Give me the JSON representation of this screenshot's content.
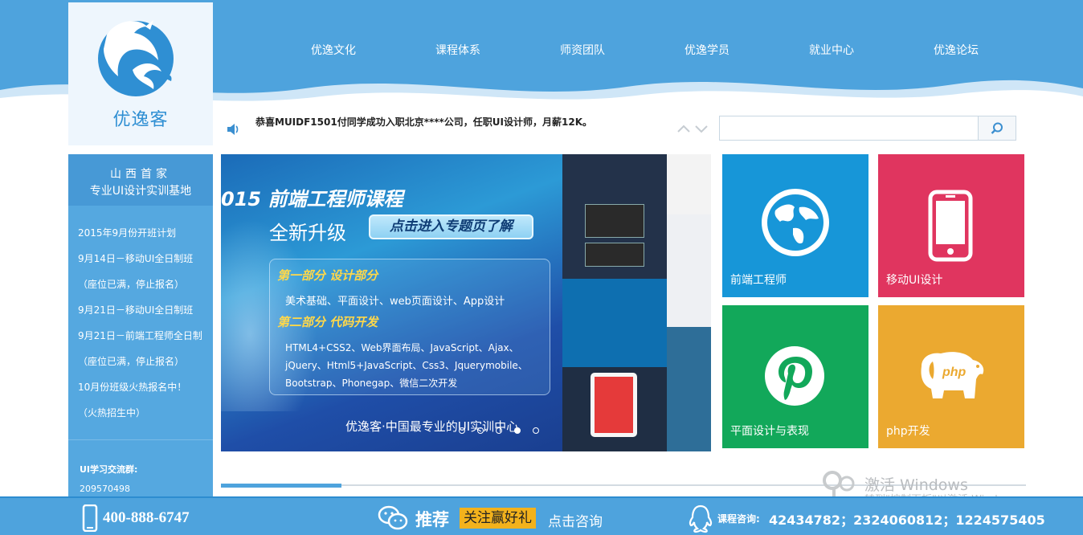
{
  "logo": {
    "text": "优逸客"
  },
  "nav": [
    "优逸文化",
    "课程体系",
    "师资团队",
    "优逸学员",
    "就业中心",
    "优逸论坛"
  ],
  "notice": {
    "text": "恭喜MUIDF1501付同学成功入职北京****公司，任职UI设计师，月薪12K。"
  },
  "search": {
    "placeholder": ""
  },
  "sidebar": {
    "heading1": "山西首家",
    "heading2": "专业UI设计实训基地",
    "items": [
      "2015年9月份开班计划",
      "9月14日－移动UI全日制班",
      "（座位已满，停止报名）",
      "9月21日－移动UI全日制班",
      "9月21日－前端工程师全日制",
      "（座位已满，停止报名）",
      "10月份班级火热报名中！",
      "（火热招生中）"
    ],
    "qq_title": "UI学习交流群:",
    "qq_number": "209570498"
  },
  "banner": {
    "title": "015 前端工程师课程",
    "subtitle": "全新升级",
    "cta": "点击进入专题页了解",
    "part1": "第一部分 设计部分",
    "part1_text": "美术基础、平面设计、web页面设计、App设计",
    "part2": "第二部分 代码开发",
    "part2_lines": [
      "HTML4+CSS2、Web界面布局、JavaScript、Ajax、",
      "jQuery、Html5+JavaScript、Css3、Jquerymobile、",
      "Bootstrap、Phonegap、微信二次开发"
    ],
    "footer": "优逸客·中国最专业的UI实训中心",
    "slide_count": 5,
    "active_slide": 4
  },
  "tiles": [
    {
      "label": "前端工程师",
      "color": "#1796d8",
      "icon": "globe-icon"
    },
    {
      "label": "移动UI设计",
      "color": "#e0355f",
      "icon": "phone-icon"
    },
    {
      "label": "平面设计与表现",
      "color": "#12a85a",
      "icon": "pinterest-icon"
    },
    {
      "label": "php开发",
      "color": "#eba930",
      "icon": "php-elephant-icon"
    }
  ],
  "carousel_progress": 0.15,
  "watermark": {
    "line1": "激活 Windows",
    "line2": "转到\"控制面板\"以激活 Windows。"
  },
  "footer": {
    "phone": "400-888-6747",
    "recommend": "推荐",
    "gift": "关注赢好礼",
    "consult": "点击咨询",
    "course_label": "课程咨询:",
    "course_numbers": "42434782；2324060812；1224575405"
  },
  "colors": {
    "primary": "#4ea3dd",
    "sidebar": "#55a8e0",
    "highlight": "#f3b21c"
  }
}
